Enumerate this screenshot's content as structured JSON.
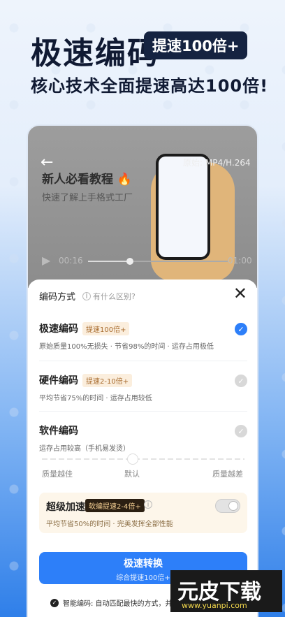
{
  "hero": {
    "title": "极速编码",
    "badge": "提速100倍+",
    "subtitle": "核心技术全面提速高达100倍!"
  },
  "video": {
    "title": "新人必看教程 🔥",
    "subtitle": "快速了解上手格式工厂",
    "overlay_label": "原始: MP4/H.264",
    "time_current": "00:16",
    "time_total": "01:00",
    "progress_fraction": 0.3
  },
  "sheet": {
    "title": "编码方式",
    "info_text": "有什么区别?",
    "options": [
      {
        "name": "极速编码",
        "tag": "提速100倍+",
        "desc": "原始质量100%无损失 · 节省98%的时间 · 运存占用极低",
        "selected": true
      },
      {
        "name": "硬件编码",
        "tag": "提速2-10倍+",
        "desc": "平均节省75%的时间 · 运存占用较低",
        "selected": false
      },
      {
        "name": "软件编码",
        "tag": "",
        "desc": "运存占用较高（手机易发烫）",
        "selected": false
      }
    ],
    "slider": {
      "left_label": "质量越佳",
      "middle_label": "默认",
      "right_label": "质量越差",
      "position_fraction": 0.5
    },
    "turbo": {
      "title": "超级加速",
      "tag": "软编提速2-4倍+",
      "desc": "平均节省50%的时间 · 完美发挥全部性能",
      "enabled": false
    },
    "convert_button": {
      "label": "极速转换",
      "sub": "综合提速100倍+"
    },
    "footer_note": "智能编码: 自动匹配最快的方式，并"
  },
  "watermark": {
    "logo": "元皮下载",
    "url": "www.yuanpi.com"
  },
  "colors": {
    "accent": "#2d7ff9",
    "dark_badge": "#152341",
    "tag_bg": "#fbeedd",
    "tag_text": "#a86c2f"
  }
}
